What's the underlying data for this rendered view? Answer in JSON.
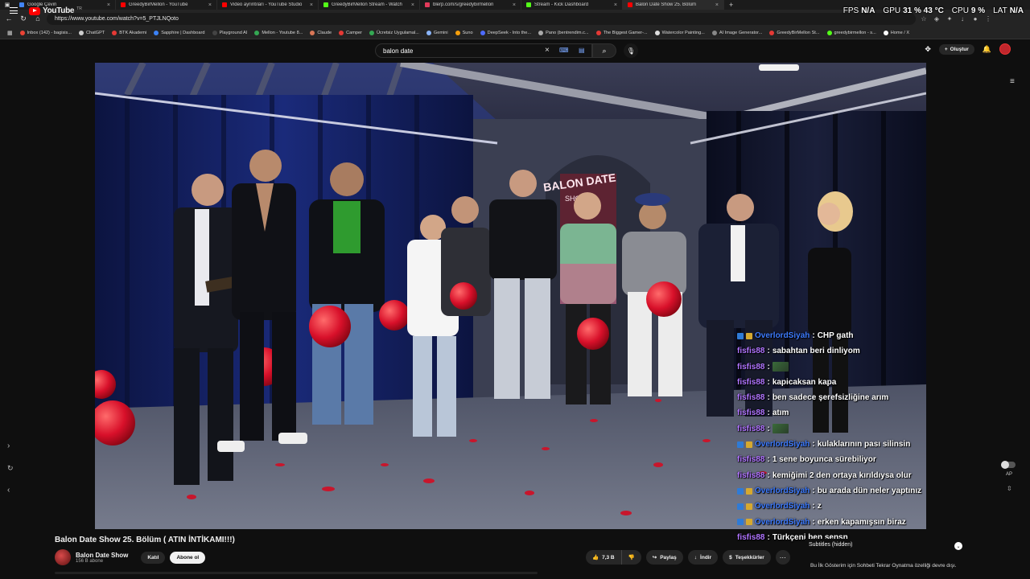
{
  "tabs": [
    {
      "label": "Google Çeviri",
      "color": "#4285f4",
      "active": false
    },
    {
      "label": "GreedyBirMellon - YouTube",
      "color": "#ff0000",
      "active": false
    },
    {
      "label": "Video ayrıntıları - YouTube Studio",
      "color": "#ff0000",
      "active": false
    },
    {
      "label": "GreedyBirMellon Stream - Watch",
      "color": "#53fc18",
      "active": false
    },
    {
      "label": "blerp.com/s/greedybirmellon",
      "color": "#e23a5a",
      "active": false
    },
    {
      "label": "Stream - Kick Dashboard",
      "color": "#53fc18",
      "active": false
    },
    {
      "label": "Balon Date Show 25. Bölüm",
      "color": "#ff0000",
      "active": true
    }
  ],
  "address": {
    "url": "https://www.youtube.com/watch?v=5_PTJLNQoto"
  },
  "bookmarks": [
    {
      "label": "Inbox (142) - bagisis...",
      "color": "#ea4335"
    },
    {
      "label": "ChatGPT",
      "color": "#cccccc"
    },
    {
      "label": "BTK Akademi",
      "color": "#e53935"
    },
    {
      "label": "Sapphire | Dashboard",
      "color": "#3b82f6"
    },
    {
      "label": "Playground AI",
      "color": "#444444"
    },
    {
      "label": "Mellon - Youtube 8...",
      "color": "#34a853"
    },
    {
      "label": "Claude",
      "color": "#d97757"
    },
    {
      "label": "Camper",
      "color": "#e53935"
    },
    {
      "label": "Ücretsiz Uygulamal...",
      "color": "#34a853"
    },
    {
      "label": "Gemini",
      "color": "#8ab4f8"
    },
    {
      "label": "Suno",
      "color": "#f59e0b"
    },
    {
      "label": "DeepSeek - Into the...",
      "color": "#4d6bfe"
    },
    {
      "label": "Pano (bentrendim.c...",
      "color": "#aaaaaa"
    },
    {
      "label": "The Biggest Gamer-...",
      "color": "#e53935"
    },
    {
      "label": "Watercolor Painting...",
      "color": "#dddddd"
    },
    {
      "label": "AI Image Generator...",
      "color": "#888888"
    },
    {
      "label": "GreedyBirMellon St...",
      "color": "#e53935"
    },
    {
      "label": "greedybirmellon - s...",
      "color": "#53fc18"
    },
    {
      "label": "Home / X",
      "color": "#ffffff"
    }
  ],
  "overlay": {
    "fps_label": "FPS",
    "fps_value": "N/A",
    "gpu_label": "GPU",
    "gpu_value": "31 %  43 °C",
    "cpu_label": "CPU",
    "cpu_value": "9 %",
    "lat_label": "LAT",
    "lat_value": "N/A"
  },
  "youtube": {
    "logo_word": "YouTube",
    "country": "TR",
    "search_value": "balon date",
    "create_label": "Oluştur"
  },
  "chat": [
    {
      "user": "OverlordSiyah",
      "color": "#3d7bff",
      "badges": 2,
      "text": "CHP gath",
      "emote": false
    },
    {
      "user": "fisfis88",
      "color": "#b074ff",
      "badges": 0,
      "text": "sabahtan beri dinliyom",
      "emote": false
    },
    {
      "user": "fisfis88",
      "color": "#b074ff",
      "badges": 0,
      "text": "",
      "emote": true
    },
    {
      "user": "fisfis88",
      "color": "#b074ff",
      "badges": 0,
      "text": "kapicaksan kapa",
      "emote": false
    },
    {
      "user": "fisfis88",
      "color": "#b074ff",
      "badges": 0,
      "text": "ben sadece şerefsizliğine arım",
      "emote": false
    },
    {
      "user": "fisfis88",
      "color": "#b074ff",
      "badges": 0,
      "text": "atım",
      "emote": false
    },
    {
      "user": "fisfis88",
      "color": "#b074ff",
      "badges": 0,
      "text": "",
      "emote": true
    },
    {
      "user": "OverlordSiyah",
      "color": "#3d7bff",
      "badges": 2,
      "text": "kulaklarının pası silinsin",
      "emote": false
    },
    {
      "user": "fisfis88",
      "color": "#b074ff",
      "badges": 0,
      "text": "1 sene boyunca sürebiliyor",
      "emote": false
    },
    {
      "user": "fisfis88",
      "color": "#b074ff",
      "badges": 0,
      "text": "kemiğimi 2 den ortaya kırıldıysa olur",
      "emote": false
    },
    {
      "user": "OverlordSiyah",
      "color": "#3d7bff",
      "badges": 2,
      "text": "bu arada dün neler yaptınız",
      "emote": false
    },
    {
      "user": "OverlordSiyah",
      "color": "#3d7bff",
      "badges": 2,
      "text": "z",
      "emote": false
    },
    {
      "user": "OverlordSiyah",
      "color": "#3d7bff",
      "badges": 2,
      "text": "erken kapamışsın biraz",
      "emote": false
    },
    {
      "user": "fisfis88",
      "color": "#b074ff",
      "badges": 0,
      "text": "Türkçeni ben senşn",
      "emote": false
    }
  ],
  "scene_sign": {
    "line1": "BALON DATE",
    "line2": "SHOW"
  },
  "video": {
    "title": "Balon Date Show 25. Bölüm ( ATIN İNTİKAMI!!!)",
    "channel": "Balon Date Show",
    "subscribers": "156 B abone",
    "join_label": "Katıl",
    "subscribe_label": "Abone ol",
    "likes": "7,3 B",
    "share_label": "Paylaş",
    "download_label": "İndir",
    "thanks_label": "Teşekkürler"
  },
  "side_panel": {
    "ap_label": "AP",
    "subtitles_label": "Subtitles (hidden)",
    "note": "Bu İlk Gösterim için Sohbeti Tekrar Oynatma özelliği devre dışı."
  }
}
